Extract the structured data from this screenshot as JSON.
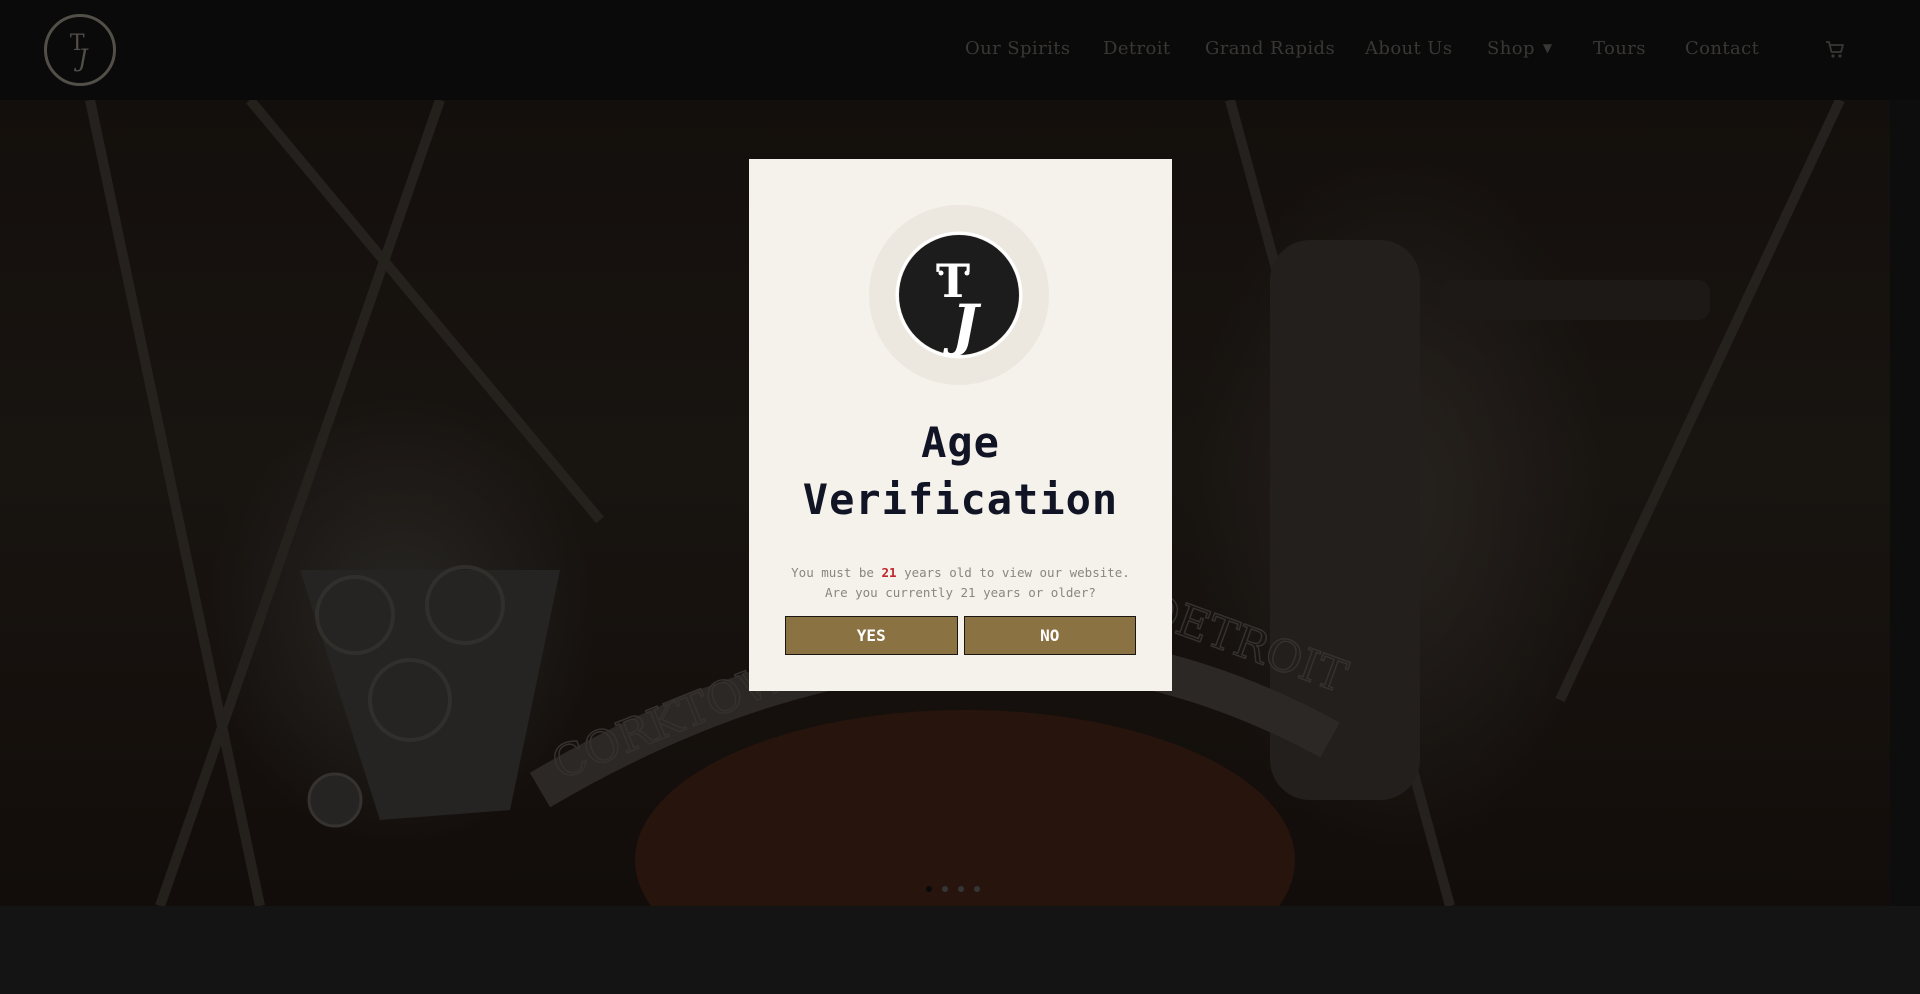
{
  "brand": {
    "logo_icon": "tj-monogram-logo-icon"
  },
  "nav": {
    "items": [
      {
        "label": "Our Spirits"
      },
      {
        "label": "Detroit"
      },
      {
        "label": "Grand Rapids"
      },
      {
        "label": "About Us"
      },
      {
        "label": "Shop",
        "has_dropdown": true
      },
      {
        "label": "Tours"
      },
      {
        "label": "Contact"
      }
    ],
    "cart_icon": "shopping-cart-icon"
  },
  "hero": {
    "slider": {
      "count": 4,
      "active_index": 0
    }
  },
  "age_gate": {
    "title_line1": "Age",
    "title_line2": "Verification",
    "message_before": "You must be",
    "age": "21",
    "message_after": "years old to view our website.",
    "question": "Are you currently 21 years or older?",
    "yes_label": "YES",
    "no_label": "NO"
  },
  "colors": {
    "modal_background": "#f5f1eb",
    "button_gold": "#8b7242",
    "age_highlight_red": "#c0262d",
    "title_navy": "#101424",
    "header_background": "#0b0b0b"
  }
}
